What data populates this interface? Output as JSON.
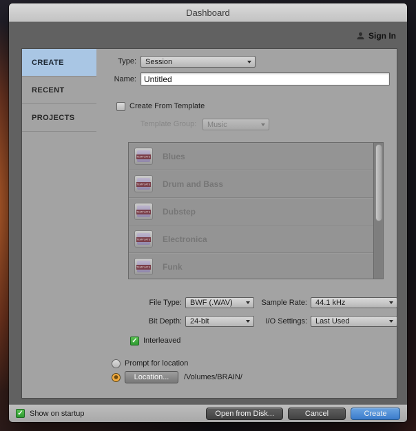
{
  "window": {
    "title": "Dashboard"
  },
  "header": {
    "sign_in_label": "Sign In"
  },
  "sidebar": {
    "items": [
      {
        "label": "CREATE"
      },
      {
        "label": "RECENT"
      },
      {
        "label": "PROJECTS"
      }
    ]
  },
  "form": {
    "type_label": "Type:",
    "type_value": "Session",
    "name_label": "Name:",
    "name_value": "Untitled",
    "create_from_template_label": "Create From Template",
    "template_group_label": "Template Group:",
    "template_group_value": "Music",
    "template_icon_text": "TEMPLATE",
    "templates": [
      "Blues",
      "Drum and Bass",
      "Dubstep",
      "Electronica",
      "Funk"
    ],
    "file_type_label": "File Type:",
    "file_type_value": "BWF (.WAV)",
    "sample_rate_label": "Sample Rate:",
    "sample_rate_value": "44.1 kHz",
    "bit_depth_label": "Bit Depth:",
    "bit_depth_value": "24-bit",
    "io_settings_label": "I/O Settings:",
    "io_settings_value": "Last Used",
    "interleaved_label": "Interleaved",
    "prompt_for_location_label": "Prompt for location",
    "location_button_label": "Location...",
    "location_path": "/Volumes/BRAIN/"
  },
  "footer": {
    "show_on_startup_label": "Show on startup",
    "open_from_disk_label": "Open from Disk...",
    "cancel_label": "Cancel",
    "create_label": "Create"
  },
  "colors": {
    "sidebar_active": "#a9c6e4",
    "create_button_blue": "#3b7bcb",
    "checkbox_green": "#2e9a31",
    "radio_orange": "#f0a93f"
  }
}
